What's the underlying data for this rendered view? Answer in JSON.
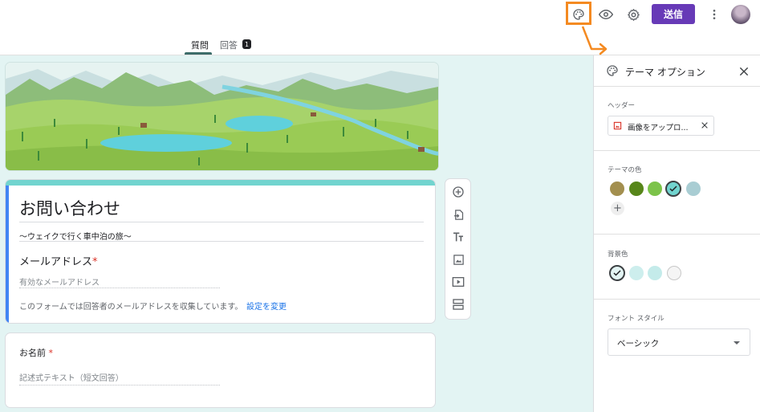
{
  "header": {
    "send_label": "送信",
    "tabs": [
      {
        "label": "質問",
        "active": true
      },
      {
        "label": "回答",
        "badge": "1"
      }
    ],
    "icons": [
      "palette-icon",
      "preview-eye-icon",
      "settings-gear-icon",
      "more-vert-icon"
    ],
    "highlight_color": "#f48a21",
    "accent_color": "#673ab7"
  },
  "form": {
    "title": "お問い合わせ",
    "description": "～ウェイクで行く車中泊の旅～",
    "email_question": {
      "label": "メールアドレス",
      "required_mark": "*",
      "placeholder": "有効なメールアドレス",
      "notice": "このフォームでは回答者のメールアドレスを収集しています。",
      "notice_link": "設定を変更"
    },
    "questions": [
      {
        "label": "お名前",
        "required_mark": "*",
        "placeholder": "記述式テキスト（短文回答）"
      }
    ]
  },
  "toolbar": {
    "tools": [
      "add-question-icon",
      "import-questions-icon",
      "add-title-icon",
      "add-image-icon",
      "add-video-icon",
      "add-section-icon"
    ]
  },
  "theme_panel": {
    "title": "テーマ オプション",
    "header_label": "ヘッダー",
    "upload_label": "画像をアップロ...",
    "theme_color_label": "テーマの色",
    "theme_colors": [
      "#a38f4f",
      "#57861a",
      "#7cc34a",
      "#71d4cf",
      "#a9cdd3"
    ],
    "selected_theme_color": "#71d4cf",
    "bg_color_label": "背景色",
    "bg_colors": [
      "#e3f4f3",
      "#cdeeed",
      "#c4ebea",
      "#f5f5f5"
    ],
    "selected_bg_color": "#e3f4f3",
    "font_style_label": "フォント スタイル",
    "font_style_value": "ベーシック"
  }
}
